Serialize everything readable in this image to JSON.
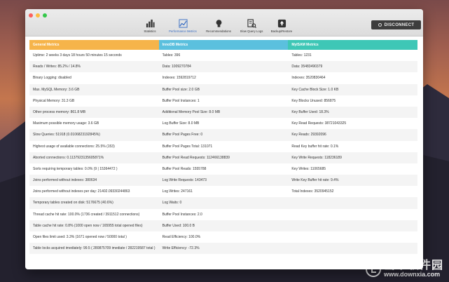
{
  "watermark": {
    "cn": "当下软件园",
    "en": "www.downxia.com"
  },
  "window": {
    "light_colors": [
      "#fc605c",
      "#fdbc40",
      "#34c84a"
    ],
    "toolbar": [
      {
        "label": "Statistics",
        "icon": "bar-chart-icon"
      },
      {
        "label": "Performance Metrics",
        "icon": "performance-chart-icon",
        "active": true
      },
      {
        "label": "Recommendations",
        "icon": "lightbulb-icon"
      },
      {
        "label": "Slow Query Logs",
        "icon": "log-search-icon"
      },
      {
        "label": "Backup/Restore",
        "icon": "backup-restore-icon"
      }
    ],
    "disconnect_label": "DISCONNECT",
    "accent": "#3a6fc4"
  },
  "table": {
    "headers": [
      {
        "label": "General Metrics",
        "color": "#f6b44a"
      },
      {
        "label": "InnoDB Metrics",
        "color": "#5bc0de"
      },
      {
        "label": "MyISAM Metrics",
        "color": "#3ec7b6"
      }
    ],
    "rows": [
      [
        "Uptime: 2 weeks 3 days 18 hours 50 minutes 15 seconds",
        "Tables: 396",
        "Tables: 1231"
      ],
      [
        "Reads / Writes: 85.2% / 14.8%",
        "Data: 1009270784",
        "Data: 35483490379"
      ],
      [
        "Binary Logging: disabled",
        "Indexes: 1592819712",
        "Indexes: 3520830464"
      ],
      [
        "Max. MySQL Memory: 3.6 GB",
        "Buffer Pool size: 2.0 GB",
        "Key Cache Block Size: 1.0 KB"
      ],
      [
        "Physical Memory: 31.3 GB",
        "Buffer Pool Instances: 1",
        "Key Blocks Unused: 856875"
      ],
      [
        "Other process memory: 861.8 MB",
        "Additional Memory Pool Size: 8.0 MB",
        "Key Buffer Used: 18.3%"
      ],
      [
        "Maximum possible memory usage: 3.6 GB",
        "Log Buffer Size: 8.0 MB",
        "Key Read Requests: 38721043325"
      ],
      [
        "Slow Queries: 51918 (0.0106823192845%)",
        "Buffer Pool Pages Free: 0",
        "Key Reads: 29392096"
      ],
      [
        "Highest usage of available connections: 25.5% (153)",
        "Buffer Pool Pages Total: 131071",
        "Read Key buffer hit rate: 0.1%"
      ],
      [
        "Aborted connections: 0.1137923135605871%",
        "Buffer Pool Read Requests: 112466138839",
        "Key Write Requests: 118236189"
      ],
      [
        "Sorts requiring temporary tables: 0.0% (9 | 15364472 )",
        "Buffer Pool Reads: 1555788",
        "Key Writes: 11065685"
      ],
      [
        "Joins performed without indexes: 380634",
        "Log Write Requests: 143473",
        "Write Key Buffer hit rate: 9.4%"
      ],
      [
        "Joins performed without indexes per day: 21402.09330244863",
        "Log Writes: 247161",
        "Total Indexes: 3520945152"
      ],
      [
        "Temporary tables created on disk: 5176675 (40.6%)",
        "Log Waits: 0",
        ""
      ],
      [
        "Thread cache hit rate: 100.0% (1736 created / 3911512 connections)",
        "Buffer Pool Instances: 2.0",
        ""
      ],
      [
        "Table cache hit rate: 0.8% (1000 open now / 165955 total opened files)",
        "Buffer Used: 100.0 B",
        ""
      ],
      [
        "Open files limit used: 3.3% (1671 opened now / 50000 total )",
        "Read Efficiency: 100.0%",
        ""
      ],
      [
        "Table locks acquired imediately: 99.5 ( 280875709 imediate / 282219587 total )",
        "Write Efficiency: -72.3%",
        ""
      ]
    ]
  }
}
